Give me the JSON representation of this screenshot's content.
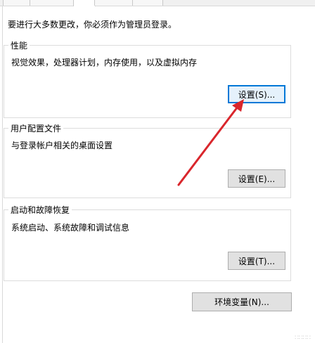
{
  "notice": "要进行大多数更改，你必须作为管理员登录。",
  "performance": {
    "title": "性能",
    "description": "视觉效果，处理器计划，内存使用，以及虚拟内存",
    "settings_button": "设置(S)..."
  },
  "user_profiles": {
    "title": "用户配置文件",
    "description": "与登录帐户相关的桌面设置",
    "settings_button": "设置(E)..."
  },
  "startup_recovery": {
    "title": "启动和故障恢复",
    "description": "系统启动、系统故障和调试信息",
    "settings_button": "设置(T)..."
  },
  "environment_variables_button": "环境变量(N)...",
  "annotation": {
    "arrow_color": "#d9262c"
  },
  "colors": {
    "focus_border": "#0078d7",
    "button_face": "#e1e1e1",
    "group_border": "#dcdcdc"
  }
}
